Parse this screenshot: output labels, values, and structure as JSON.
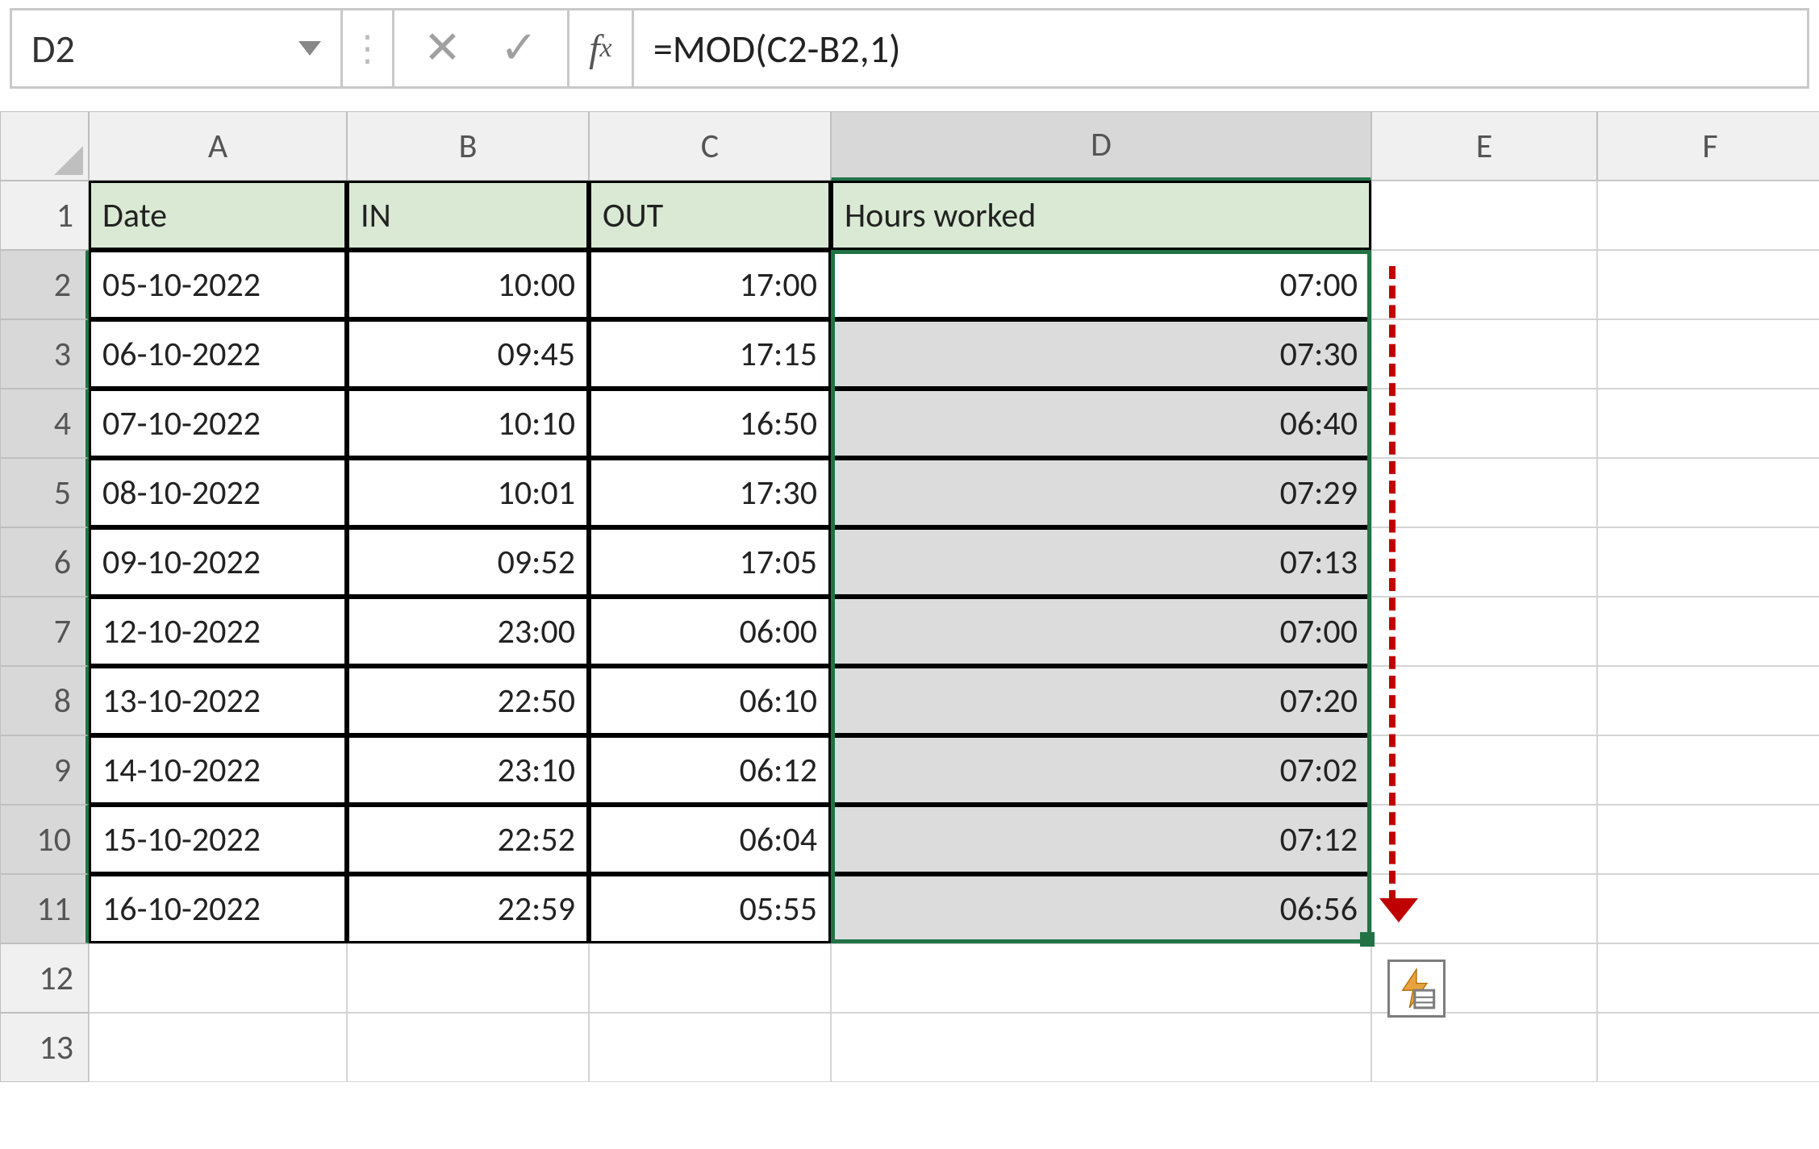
{
  "nameBox": "D2",
  "formula": "=MOD(C2-B2,1)",
  "columns": [
    "A",
    "B",
    "C",
    "D",
    "E",
    "F"
  ],
  "rowCount": 13,
  "headerRow": {
    "a": "Date",
    "b": "IN",
    "c": "OUT",
    "d": "Hours worked"
  },
  "data": [
    {
      "a": "05-10-2022",
      "b": "10:00",
      "c": "17:00",
      "d": "07:00"
    },
    {
      "a": "06-10-2022",
      "b": "09:45",
      "c": "17:15",
      "d": "07:30"
    },
    {
      "a": "07-10-2022",
      "b": "10:10",
      "c": "16:50",
      "d": "06:40"
    },
    {
      "a": "08-10-2022",
      "b": "10:01",
      "c": "17:30",
      "d": "07:29"
    },
    {
      "a": "09-10-2022",
      "b": "09:52",
      "c": "17:05",
      "d": "07:13"
    },
    {
      "a": "12-10-2022",
      "b": "23:00",
      "c": "06:00",
      "d": "07:00"
    },
    {
      "a": "13-10-2022",
      "b": "22:50",
      "c": "06:10",
      "d": "07:20"
    },
    {
      "a": "14-10-2022",
      "b": "23:10",
      "c": "06:12",
      "d": "07:02"
    },
    {
      "a": "15-10-2022",
      "b": "22:52",
      "c": "06:04",
      "d": "07:12"
    },
    {
      "a": "16-10-2022",
      "b": "22:59",
      "c": "05:55",
      "d": "06:56"
    }
  ],
  "autoFillIconName": "auto-fill-options-icon"
}
